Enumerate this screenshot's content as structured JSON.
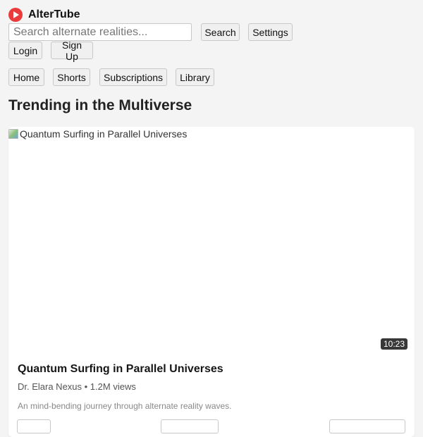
{
  "brand": {
    "name": "AlterTube",
    "logo_color": "#e93b3b"
  },
  "header": {
    "search_placeholder": "Search alternate realities...",
    "search_label": "Search",
    "settings_label": "Settings",
    "login_label": "Login",
    "signup_label": "Sign Up"
  },
  "nav": {
    "items": [
      {
        "label": "Home"
      },
      {
        "label": "Shorts"
      },
      {
        "label": "Subscriptions"
      },
      {
        "label": "Library"
      }
    ]
  },
  "section": {
    "title": "Trending in the Multiverse"
  },
  "video": {
    "thumbnail_alt": "Quantum Surfing in Parallel Universes",
    "duration": "10:23",
    "title": "Quantum Surfing in Parallel Universes",
    "meta": "Dr. Elara Nexus • 1.2M views",
    "description": "An mind-bending journey through alternate reality waves."
  },
  "icons": {
    "logo": "play-logo-icon",
    "thumbnail": "broken-image-icon"
  }
}
